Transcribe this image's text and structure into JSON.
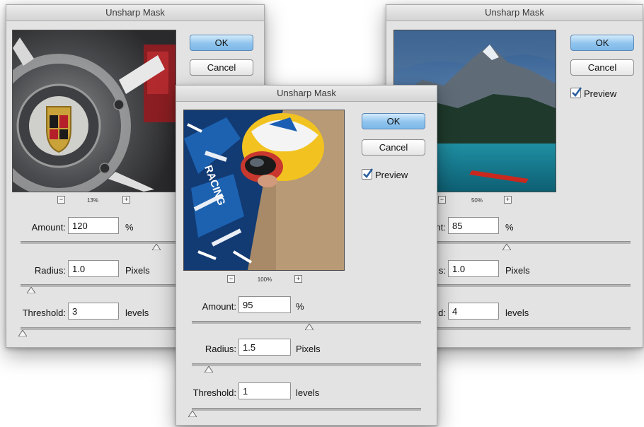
{
  "dialogs": {
    "left": {
      "title": "Unsharp Mask",
      "ok_label": "OK",
      "cancel_label": "Cancel",
      "zoom": "13%",
      "amount": {
        "label": "Amount:",
        "value": "120",
        "unit": "%"
      },
      "radius": {
        "label": "Radius:",
        "value": "1.0",
        "unit": "Pixels"
      },
      "threshold": {
        "label": "Threshold:",
        "value": "3",
        "unit": "levels"
      }
    },
    "right": {
      "title": "Unsharp Mask",
      "ok_label": "OK",
      "cancel_label": "Cancel",
      "preview_label": "Preview",
      "zoom": "50%",
      "amount": {
        "label": "nt:",
        "value": "85",
        "unit": "%"
      },
      "radius": {
        "label": "s:",
        "value": "1.0",
        "unit": "Pixels"
      },
      "threshold": {
        "label": "d:",
        "value": "4",
        "unit": "levels"
      }
    },
    "center": {
      "title": "Unsharp Mask",
      "ok_label": "OK",
      "cancel_label": "Cancel",
      "preview_label": "Preview",
      "zoom": "100%",
      "amount": {
        "label": "Amount:",
        "value": "95",
        "unit": "%"
      },
      "radius": {
        "label": "Radius:",
        "value": "1.5",
        "unit": "Pixels"
      },
      "threshold": {
        "label": "Threshold:",
        "value": "1",
        "unit": "levels"
      }
    }
  },
  "colors": {
    "ok_button": "#8fc4ee",
    "dialog_bg": "#e3e3e3",
    "checkmark": "#2a5fa0"
  },
  "icons": {
    "zoom_out": "minus-square-icon",
    "zoom_in": "plus-square-icon",
    "slider": "triangle-slider-thumb-icon"
  }
}
